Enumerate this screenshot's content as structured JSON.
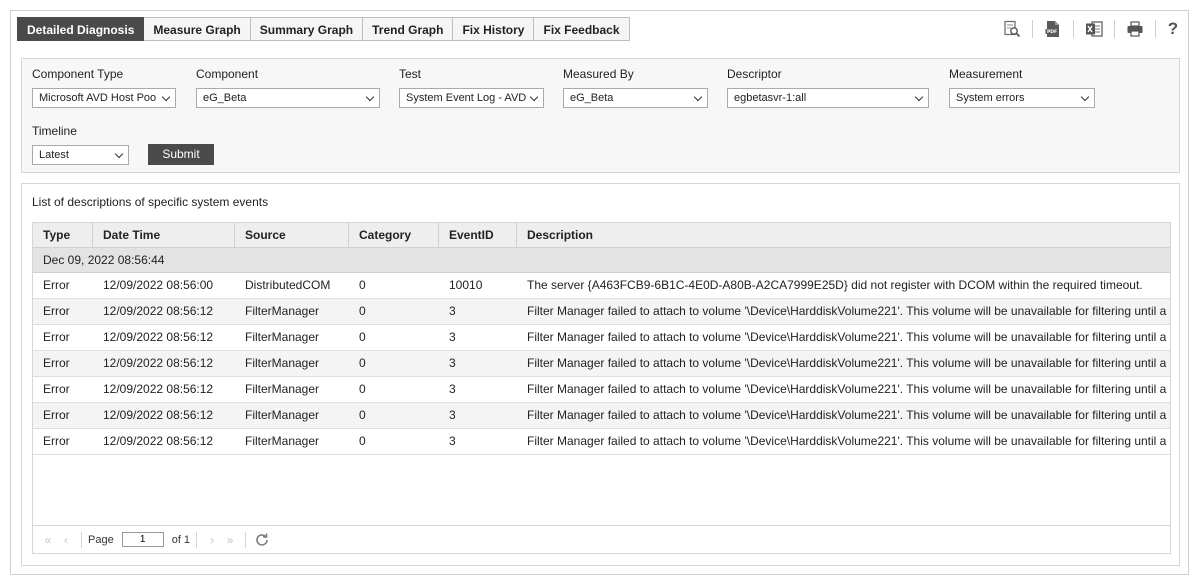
{
  "tabs": [
    {
      "label": "Detailed Diagnosis",
      "active": true
    },
    {
      "label": "Measure Graph"
    },
    {
      "label": "Summary Graph"
    },
    {
      "label": "Trend Graph"
    },
    {
      "label": "Fix History"
    },
    {
      "label": "Fix Feedback"
    }
  ],
  "toolbar": {
    "icons": [
      "search-report-icon",
      "pdf-icon",
      "excel-icon",
      "print-icon",
      "help-icon"
    ],
    "help_label": "?"
  },
  "filters": {
    "component_type": {
      "label": "Component Type",
      "value": "Microsoft AVD Host Poo"
    },
    "component": {
      "label": "Component",
      "value": "eG_Beta"
    },
    "test": {
      "label": "Test",
      "value": "System Event Log - AVD"
    },
    "measured_by": {
      "label": "Measured By",
      "value": "eG_Beta"
    },
    "descriptor": {
      "label": "Descriptor",
      "value": "egbetasvr-1:all"
    },
    "measurement": {
      "label": "Measurement",
      "value": "System errors"
    },
    "timeline": {
      "label": "Timeline",
      "value": "Latest"
    },
    "submit_label": "Submit"
  },
  "results": {
    "title": "List of descriptions of specific system events",
    "columns": [
      "Type",
      "Date Time",
      "Source",
      "Category",
      "EventID",
      "Description"
    ],
    "group_label": "Dec 09, 2022 08:56:44",
    "rows": [
      {
        "type": "Error",
        "datetime": "12/09/2022 08:56:00",
        "source": "DistributedCOM",
        "category": "0",
        "eventid": "10010",
        "description": "The server {A463FCB9-6B1C-4E0D-A80B-A2CA7999E25D} did not register with DCOM within the required timeout."
      },
      {
        "type": "Error",
        "datetime": "12/09/2022 08:56:12",
        "source": "FilterManager",
        "category": "0",
        "eventid": "3",
        "description": "Filter Manager failed to attach to volume '\\Device\\HarddiskVolume221'. This volume will be unavailable for filtering until a reboot."
      },
      {
        "type": "Error",
        "datetime": "12/09/2022 08:56:12",
        "source": "FilterManager",
        "category": "0",
        "eventid": "3",
        "description": "Filter Manager failed to attach to volume '\\Device\\HarddiskVolume221'. This volume will be unavailable for filtering until a reboot."
      },
      {
        "type": "Error",
        "datetime": "12/09/2022 08:56:12",
        "source": "FilterManager",
        "category": "0",
        "eventid": "3",
        "description": "Filter Manager failed to attach to volume '\\Device\\HarddiskVolume221'. This volume will be unavailable for filtering until a reboot."
      },
      {
        "type": "Error",
        "datetime": "12/09/2022 08:56:12",
        "source": "FilterManager",
        "category": "0",
        "eventid": "3",
        "description": "Filter Manager failed to attach to volume '\\Device\\HarddiskVolume221'. This volume will be unavailable for filtering until a reboot."
      },
      {
        "type": "Error",
        "datetime": "12/09/2022 08:56:12",
        "source": "FilterManager",
        "category": "0",
        "eventid": "3",
        "description": "Filter Manager failed to attach to volume '\\Device\\HarddiskVolume221'. This volume will be unavailable for filtering until a reboot."
      },
      {
        "type": "Error",
        "datetime": "12/09/2022 08:56:12",
        "source": "FilterManager",
        "category": "0",
        "eventid": "3",
        "description": "Filter Manager failed to attach to volume '\\Device\\HarddiskVolume221'. This volume will be unavailable for filtering until a reboot."
      }
    ]
  },
  "pager": {
    "page_label": "Page",
    "page_value": "1",
    "of_label": "of 1"
  }
}
